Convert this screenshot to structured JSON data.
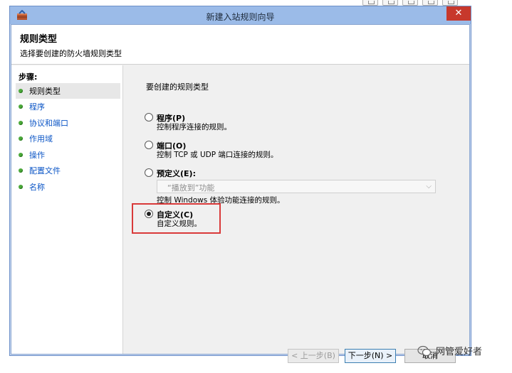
{
  "window": {
    "title": "新建入站规则向导",
    "close_glyph": "✕"
  },
  "header": {
    "title": "规则类型",
    "subtitle": "选择要创建的防火墙规则类型"
  },
  "sidebar": {
    "steps_label": "步骤:",
    "items": [
      {
        "label": "规则类型",
        "active": true
      },
      {
        "label": "程序",
        "active": false
      },
      {
        "label": "协议和端口",
        "active": false
      },
      {
        "label": "作用域",
        "active": false
      },
      {
        "label": "操作",
        "active": false
      },
      {
        "label": "配置文件",
        "active": false
      },
      {
        "label": "名称",
        "active": false
      }
    ]
  },
  "main": {
    "prompt": "要创建的规则类型",
    "options": [
      {
        "label": "程序(P)",
        "desc": "控制程序连接的规则。",
        "checked": false
      },
      {
        "label": "端口(O)",
        "desc": "控制 TCP 或 UDP 端口连接的规则。",
        "checked": false
      },
      {
        "label": "预定义(E):",
        "desc": "",
        "checked": false
      },
      {
        "label": "自定义(C)",
        "desc": "自定义规则。",
        "checked": true
      }
    ],
    "preset_select_value": "“播放到”功能",
    "preset_desc": "控制 Windows 体验功能连接的规则。"
  },
  "buttons": {
    "back": "< 上一步(B)",
    "next": "下一步(N) >",
    "cancel": "取消"
  },
  "watermark": {
    "text": "网管爱好者"
  },
  "colors": {
    "titlebar": "#9bbbe8",
    "close": "#c7382c",
    "highlight": "#d93a3a",
    "step_link": "#0b55c6"
  }
}
